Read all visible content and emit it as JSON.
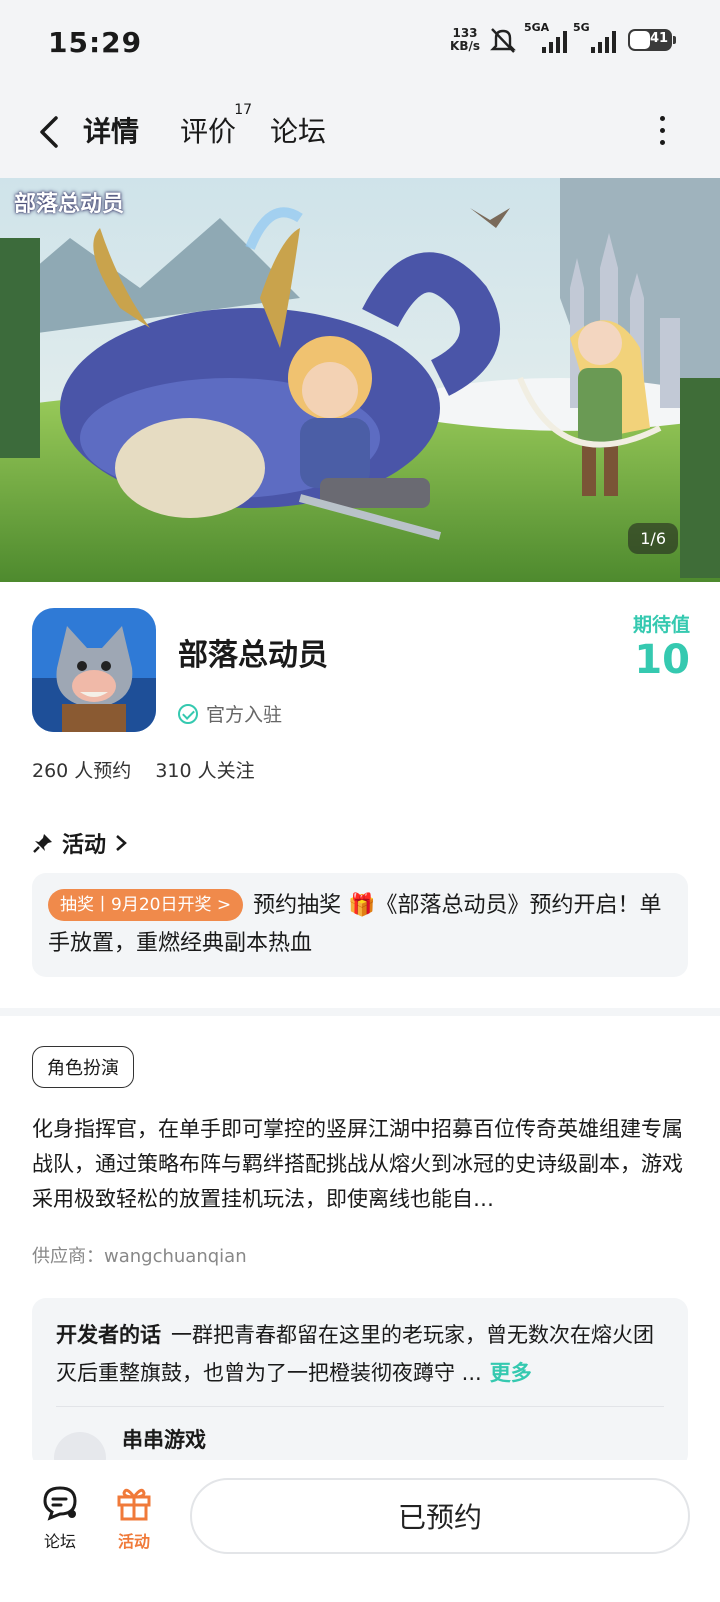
{
  "status_bar": {
    "time": "15:29",
    "speed_value": "133",
    "speed_unit": "KB/s",
    "sim1_label": "5GA",
    "sim2_label": "5G",
    "battery": "41"
  },
  "nav": {
    "tabs": [
      {
        "label": "详情",
        "active": true
      },
      {
        "label": "评价",
        "badge": "17"
      },
      {
        "label": "论坛"
      }
    ]
  },
  "banner": {
    "logo_text": "部落总动员",
    "counter": "1/6"
  },
  "app": {
    "name": "部落总动员",
    "official_label": "官方入驻",
    "expect_label": "期待值",
    "expect_value": "10",
    "reservations": "260 人预约",
    "followers": "310 人关注"
  },
  "activity": {
    "heading": "活动",
    "tag": "抽奖丨9月20日开奖 >",
    "text": "预约抽奖 🎁《部落总动员》预约开启！单手放置，重燃经典副本热血"
  },
  "description": {
    "genre": "角色扮演",
    "text": "化身指挥官，在单手即可掌控的竖屏江湖中招募百位传奇英雄组建专属战队，通过策略布阵与羁绊搭配挑战从熔火到冰冠的史诗级副本，游戏采用极致轻松的放置挂机玩法，即使离线也能自…",
    "supplier": "供应商：wangchuanqian"
  },
  "developer": {
    "label": "开发者的话",
    "text": "一群把青春都留在这里的老玩家，曾无数次在熔火团灭后重整旗鼓，也曾为了一把橙装彻夜蹲守 ...",
    "more": "更多",
    "author": "串串游戏"
  },
  "bottom_bar": {
    "forum_label": "论坛",
    "activity_label": "活动",
    "reserve_label": "已预约"
  },
  "colors": {
    "accent": "#35c9b0",
    "orange": "#f08a4b"
  }
}
